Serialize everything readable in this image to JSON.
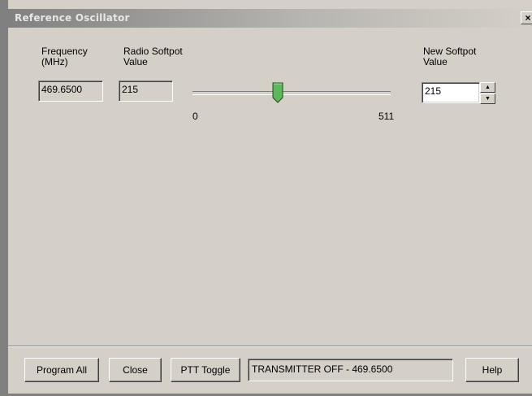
{
  "window": {
    "title": "Reference Oscillator",
    "close_label": "×"
  },
  "fields": {
    "frequency_label_1": "Frequency",
    "frequency_label_2": "(MHz)",
    "frequency_value": "469.6500",
    "radio_softpot_label_1": "Radio Softpot",
    "radio_softpot_label_2": "Value",
    "radio_softpot_value": "215",
    "new_softpot_label_1": "New Softpot",
    "new_softpot_label_2": "Value",
    "new_softpot_value": "215"
  },
  "slider": {
    "min_label": "0",
    "max_label": "511",
    "min": 0,
    "max": 511,
    "value": 215,
    "thumb_color": "#5cb85c"
  },
  "buttons": {
    "program_all": "Program All",
    "close": "Close",
    "ptt_toggle": "PTT Toggle",
    "help": "Help"
  },
  "status": {
    "text": "TRANSMITTER OFF - 469.6500"
  },
  "icons": {
    "spin_up": "spin-up-arrow-icon",
    "spin_down": "spin-down-arrow-icon"
  }
}
